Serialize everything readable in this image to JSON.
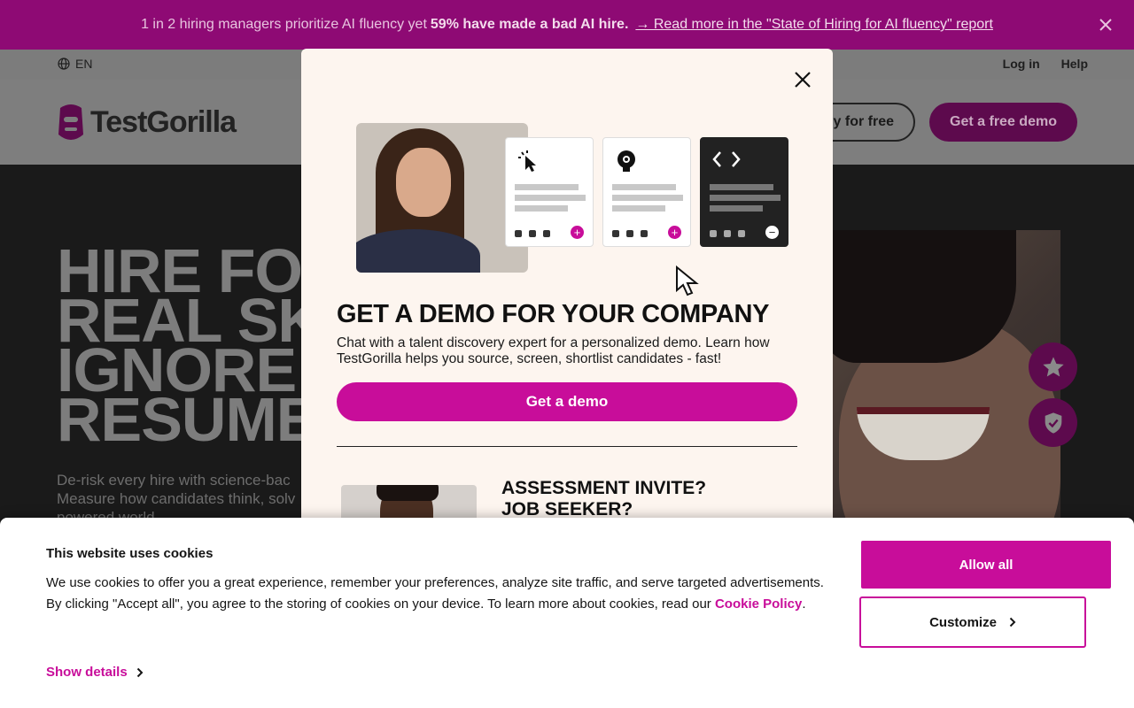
{
  "announcement": {
    "text_before": "1 in 2 hiring managers prioritize AI fluency yet",
    "text_bold": "59% have made a bad AI hire.",
    "link": "→ Read more in the \"State of Hiring for AI fluency\" report"
  },
  "utility": {
    "language": "EN",
    "login": "Log in",
    "help": "Help"
  },
  "header": {
    "logo_text": "TestGorilla",
    "try_button": "Try for free",
    "try_visible": "y for free",
    "demo_button": "Get a free demo"
  },
  "hero": {
    "title_lines": [
      "HIRE FO",
      "REAL SK",
      "IGNORE",
      "RESUME"
    ],
    "subtitle": "De-risk every hire with science-bac Measure how candidates think, solv powered world."
  },
  "modal": {
    "title": "GET A DEMO FOR YOUR COMPANY",
    "text": "Chat with a talent discovery expert for a personalized demo. Learn how TestGorilla helps you source, screen, shortlist candidates - fast!",
    "button": "Get a demo",
    "seeker_title_1": "ASSESSMENT INVITE?",
    "seeker_title_2": "JOB SEEKER?"
  },
  "cookie": {
    "title": "This website uses cookies",
    "text": "We use cookies to offer you a great experience, remember your preferences, analyze site traffic, and serve targeted advertisements. By clicking \"Accept all\", you agree to the storing of cookies on your device. To learn more about cookies, read our",
    "policy_link": "Cookie Policy",
    "period": ".",
    "show_details": "Show details",
    "allow_all": "Allow all",
    "customize": "Customize"
  },
  "colors": {
    "brand": "#c80d9a",
    "announce_bg": "#8e0a74"
  }
}
